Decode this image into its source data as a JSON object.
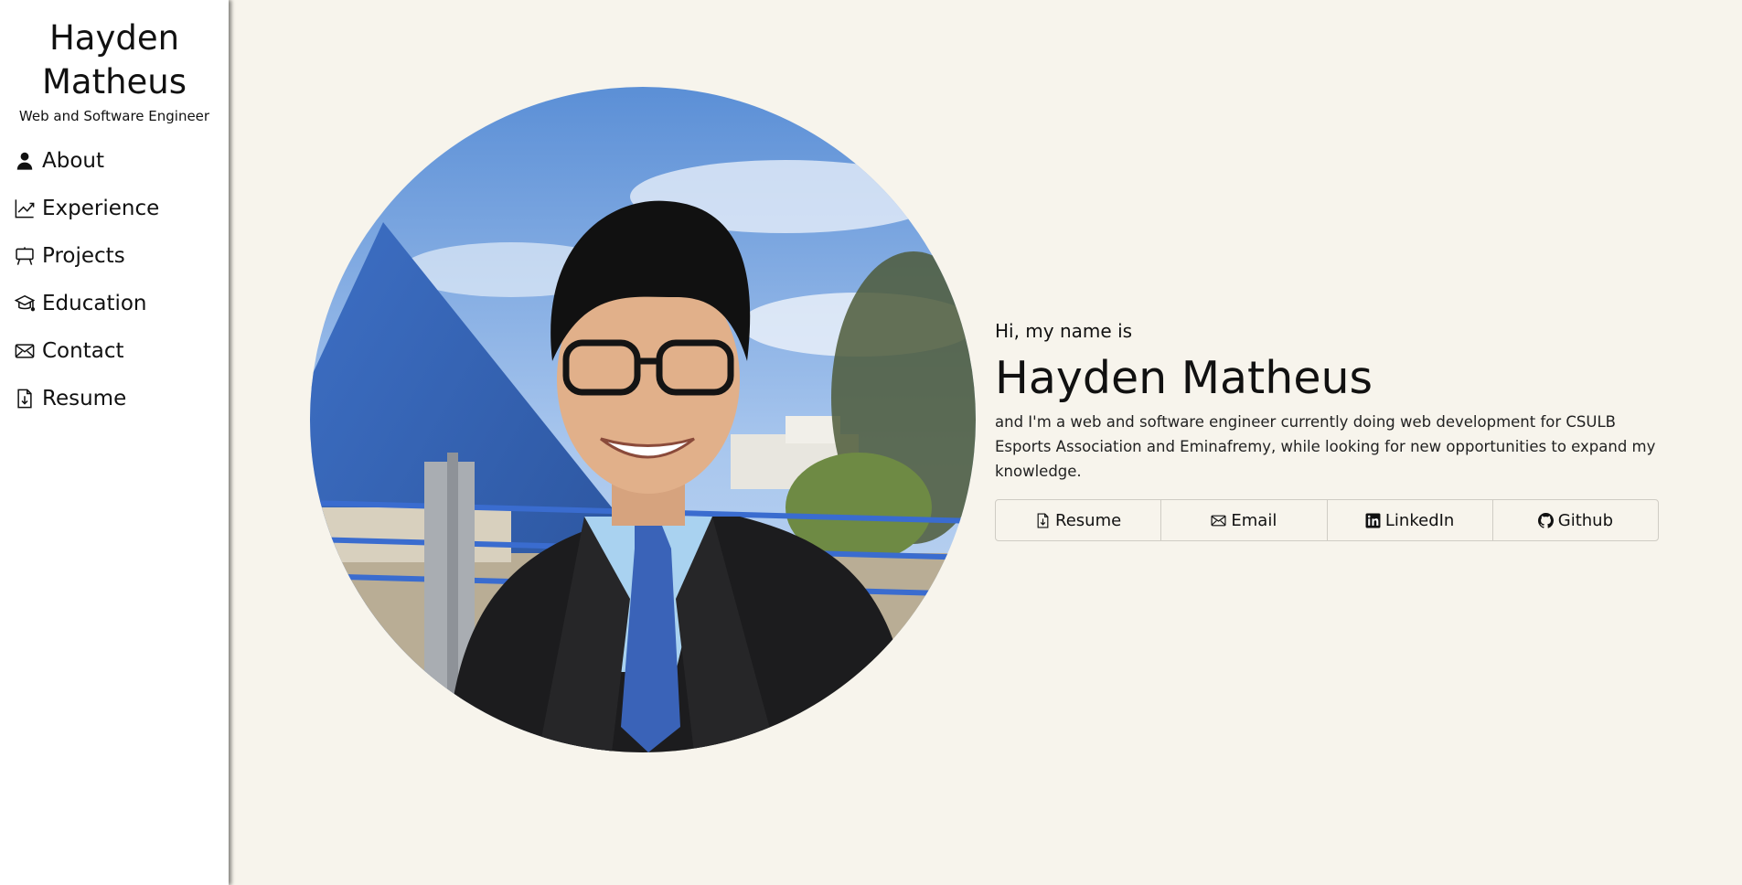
{
  "sidebar": {
    "brand_name_line1": "Hayden",
    "brand_name_line2": "Matheus",
    "tagline": "Web and Software Engineer",
    "items": [
      {
        "label": "About",
        "icon": "person-icon"
      },
      {
        "label": "Experience",
        "icon": "graph-up-icon"
      },
      {
        "label": "Projects",
        "icon": "easel-icon"
      },
      {
        "label": "Education",
        "icon": "mortarboard-icon"
      },
      {
        "label": "Contact",
        "icon": "envelope-icon"
      },
      {
        "label": "Resume",
        "icon": "file-download-icon"
      }
    ]
  },
  "hero": {
    "greeting": "Hi, my name is",
    "name": "Hayden Matheus",
    "bio": "and I'm a web and software engineer currently doing web development for CSULB Esports Association and Eminafremy, while looking for new opportunities to expand my knowledge.",
    "links": [
      {
        "label": "Resume",
        "icon": "file-download-icon"
      },
      {
        "label": "Email",
        "icon": "envelope-icon"
      },
      {
        "label": "LinkedIn",
        "icon": "linkedin-icon"
      },
      {
        "label": "Github",
        "icon": "github-icon"
      }
    ]
  },
  "colors": {
    "background": "#f7f4ec",
    "sidebar": "#ffffff",
    "text": "#111111"
  }
}
